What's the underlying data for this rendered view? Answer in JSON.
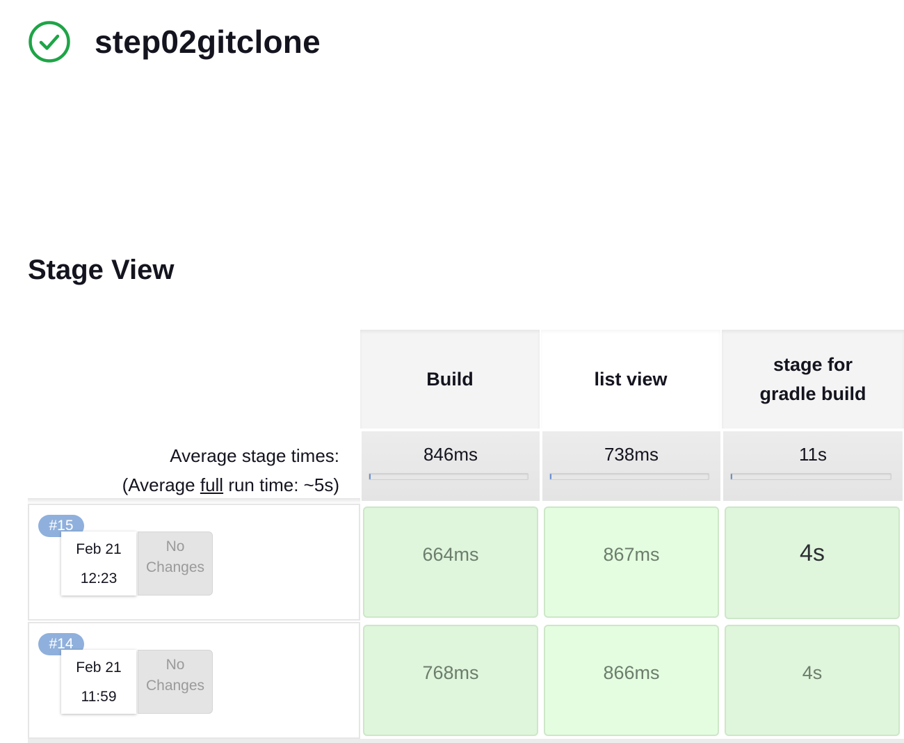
{
  "job": {
    "title": "step02gitclone",
    "status_icon": "check-circle-icon",
    "status_color": "#1ea446"
  },
  "stage_view": {
    "title": "Stage View",
    "avg_label_line1": "Average stage times:",
    "avg_label_prefix": "(Average ",
    "avg_label_link": "full",
    "avg_label_suffix": " run time: ~5s)",
    "stages": [
      {
        "name": "Build",
        "avg": "846ms",
        "avg_fraction": 0.01
      },
      {
        "name": "list view",
        "avg": "738ms",
        "avg_fraction": 0.01
      },
      {
        "name_line1": "stage for",
        "name_line2": "gradle build",
        "avg": "11s",
        "avg_fraction": 0.01
      }
    ],
    "runs": [
      {
        "number": "#15",
        "date": "Feb 21",
        "time": "12:23",
        "changes_line1": "No",
        "changes_line2": "Changes",
        "durations": [
          "664ms",
          "867ms",
          "4s"
        ]
      },
      {
        "number": "#14",
        "date": "Feb 21",
        "time": "11:59",
        "changes_line1": "No",
        "changes_line2": "Changes",
        "durations": [
          "768ms",
          "866ms",
          "4s"
        ]
      }
    ],
    "colors": {
      "success_cell": "#dff5dc",
      "success_cell_alt": "#e4fde0",
      "badge": "#8fb0dc",
      "progress": "#6a8fd1"
    }
  }
}
